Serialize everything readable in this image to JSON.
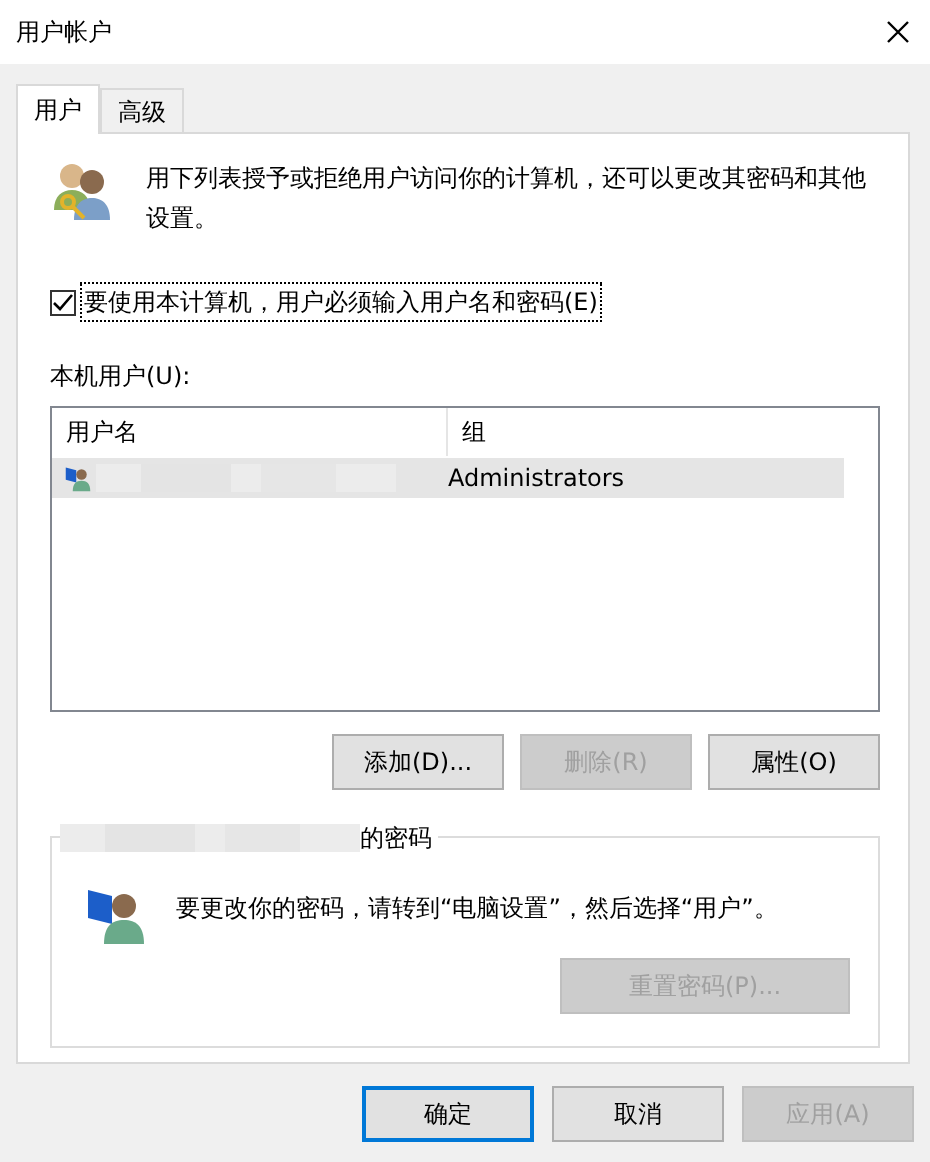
{
  "window": {
    "title": "用户帐户"
  },
  "tabs": [
    {
      "label": "用户",
      "selected": true
    },
    {
      "label": "高级",
      "selected": false
    }
  ],
  "intro": "用下列表授予或拒绝用户访问你的计算机，还可以更改其密码和其他设置。",
  "require_password": {
    "label": "要使用本计算机，用户必须输入用户名和密码(E)",
    "checked": true
  },
  "users_label": "本机用户(U):",
  "table": {
    "columns": [
      "用户名",
      "组"
    ],
    "rows": [
      {
        "group": "Administrators",
        "selected": true
      }
    ]
  },
  "list_buttons": [
    {
      "label": "添加(D)...",
      "disabled": false
    },
    {
      "label": "删除(R)",
      "disabled": true
    },
    {
      "label": "属性(O)",
      "disabled": false
    }
  ],
  "password_group": {
    "title": "的密码",
    "message": "要更改你的密码，请转到“电脑设置”，然后选择“用户”。",
    "button": {
      "label": "重置密码(P)...",
      "disabled": true
    }
  },
  "dialog_buttons": [
    {
      "label": "确定",
      "default": true,
      "disabled": false
    },
    {
      "label": "取消",
      "default": false,
      "disabled": false
    },
    {
      "label": "应用(A)",
      "default": false,
      "disabled": true
    }
  ]
}
